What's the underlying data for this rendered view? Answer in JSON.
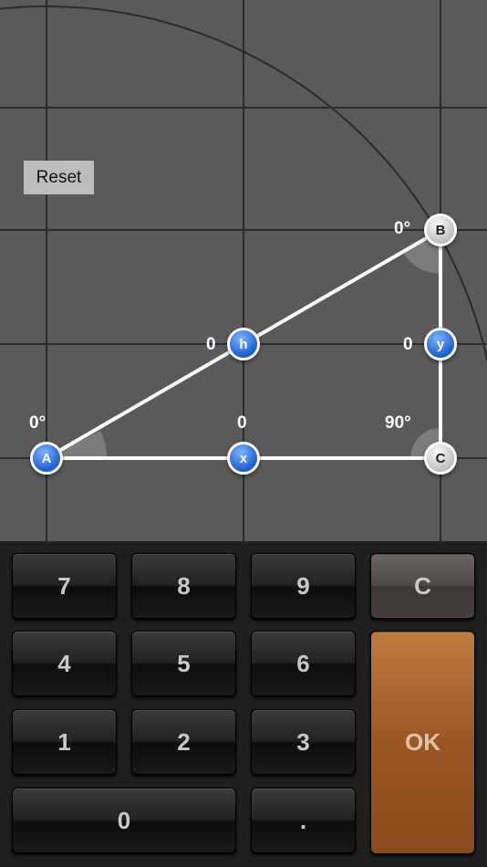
{
  "reset_label": "Reset",
  "colors": {
    "background": "#5a5a5a",
    "grid": "#2a2a2a",
    "triangle": "#ffffff",
    "node_blue": "#2a6fe0",
    "node_grey": "#cfcfcf",
    "ok_key": "#9a5724"
  },
  "triangle": {
    "vertices": {
      "A": "A",
      "B": "B",
      "C": "C"
    },
    "sides": {
      "hypotenuse": "h",
      "base": "x",
      "height": "y"
    },
    "angles": {
      "A": "0°",
      "B": "0°",
      "C": "90°"
    },
    "lengths": {
      "h": "0",
      "x": "0",
      "y": "0"
    }
  },
  "keypad": {
    "k7": "7",
    "k8": "8",
    "k9": "9",
    "clear": "C",
    "k4": "4",
    "k5": "5",
    "k6": "6",
    "k1": "1",
    "k2": "2",
    "k3": "3",
    "ok": "OK",
    "k0": "0",
    "dot": "."
  }
}
